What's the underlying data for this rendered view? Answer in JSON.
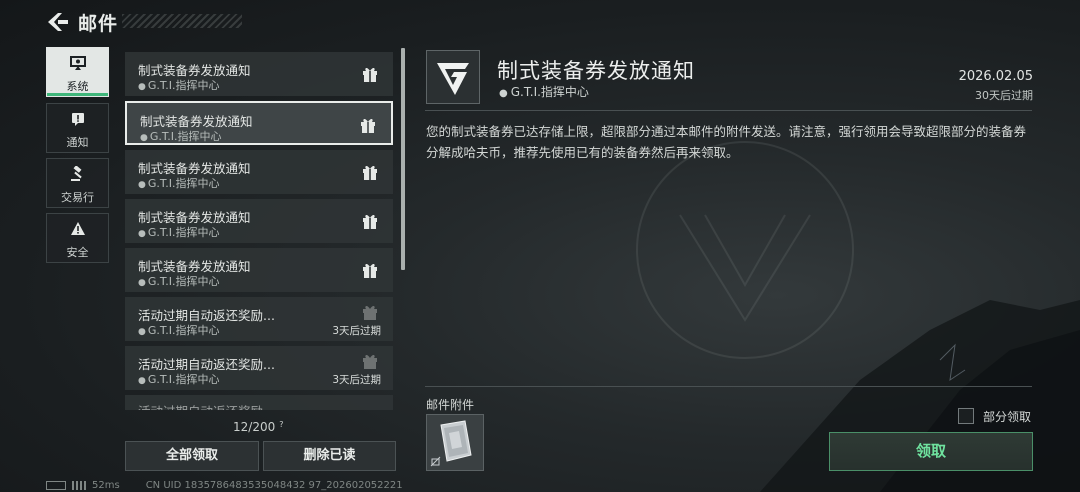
{
  "header": {
    "title": "邮件"
  },
  "tabs": [
    {
      "label": "系统",
      "icon": "monitor-icon",
      "active": true
    },
    {
      "label": "通知",
      "icon": "alert-icon",
      "active": false
    },
    {
      "label": "交易行",
      "icon": "gavel-icon",
      "active": false
    },
    {
      "label": "安全",
      "icon": "warning-icon",
      "active": false
    }
  ],
  "mails": [
    {
      "title": "制式装备券发放通知",
      "sender": "G.T.I.指挥中心",
      "expire": "",
      "selected": false
    },
    {
      "title": "制式装备券发放通知",
      "sender": "G.T.I.指挥中心",
      "expire": "",
      "selected": true
    },
    {
      "title": "制式装备券发放通知",
      "sender": "G.T.I.指挥中心",
      "expire": "",
      "selected": false
    },
    {
      "title": "制式装备券发放通知",
      "sender": "G.T.I.指挥中心",
      "expire": "",
      "selected": false
    },
    {
      "title": "制式装备券发放通知",
      "sender": "G.T.I.指挥中心",
      "expire": "",
      "selected": false
    },
    {
      "title": "活动过期自动返还奖励...",
      "sender": "G.T.I.指挥中心",
      "expire": "3天后过期",
      "selected": false
    },
    {
      "title": "活动过期自动返还奖励...",
      "sender": "G.T.I.指挥中心",
      "expire": "3天后过期",
      "selected": false
    },
    {
      "title": "活动过期自动返还奖励",
      "sender": "",
      "expire": "",
      "selected": false
    }
  ],
  "list_footer": {
    "counter": "12/200",
    "help": "?",
    "claim_all": "全部领取",
    "delete_read": "删除已读"
  },
  "detail": {
    "title": "制式装备券发放通知",
    "sender": "G.T.I.指挥中心",
    "date": "2026.02.05",
    "expire": "30天后过期",
    "body": "您的制式装备券已达存储上限，超限部分通过本邮件的附件发送。请注意，强行领用会导致超限部分的装备券分解成哈夫币，推荐先使用已有的装备券然后再来领取。",
    "attachments_label": "邮件附件",
    "partial_claim_label": "部分领取",
    "claim_label": "领取"
  },
  "status": {
    "ping": "52ms",
    "uid": "CN UID 1835786483535048432 97_202602052221"
  },
  "colors": {
    "accent_green": "#6fe39f",
    "active_tab_bar": "#3fb67a"
  }
}
